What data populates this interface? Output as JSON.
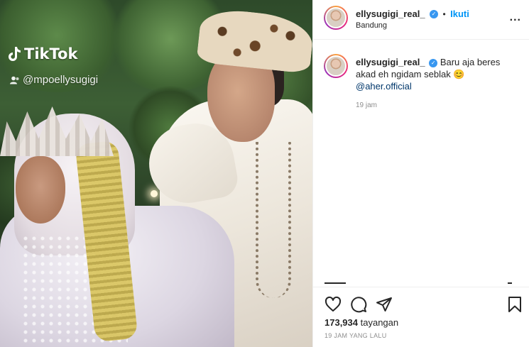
{
  "media": {
    "watermark_brand": "TikTok",
    "watermark_handle": "@mpoellysugigi"
  },
  "header": {
    "username": "ellysugigi_real_",
    "separator": "•",
    "follow_label": "Ikuti",
    "location": "Bandung",
    "more_label": "..."
  },
  "caption": {
    "username": "ellysugigi_real_",
    "text": "Baru aja beres akad eh ngidam seblak 😊",
    "mention": "@aher.official",
    "time": "19 jam"
  },
  "actions": {
    "icons": [
      "heart-icon",
      "comment-icon",
      "share-icon",
      "bookmark-icon"
    ]
  },
  "stats": {
    "views_count": "173,934",
    "views_label": "tayangan",
    "posted_ago": "19 JAM YANG LALU"
  },
  "colors": {
    "link": "#0095f6",
    "mention": "#00376b",
    "verified": "#3897f0",
    "muted": "#8e8e8e",
    "text": "#262626"
  }
}
